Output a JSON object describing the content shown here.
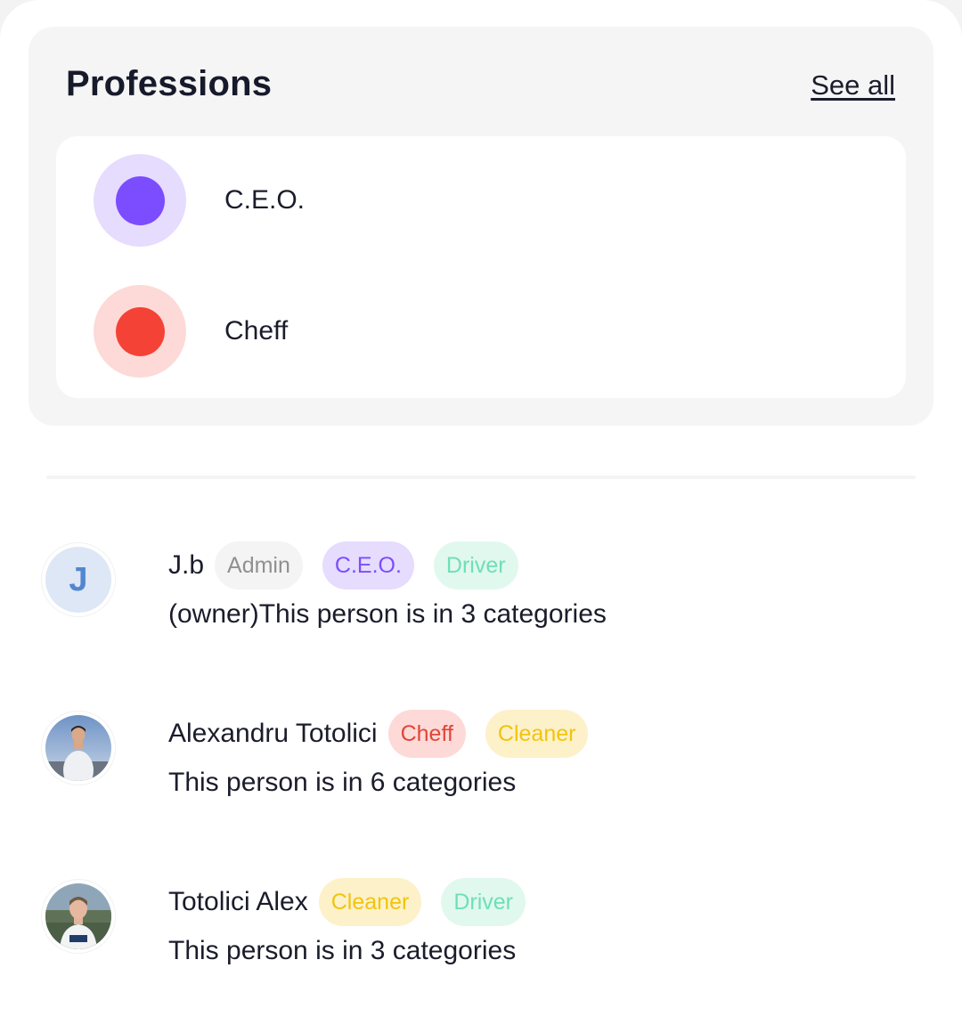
{
  "professions": {
    "title": "Professions",
    "see_all_label": "See all",
    "items": [
      {
        "label": "C.E.O.",
        "outer_color": "#e6dcfd",
        "inner_color": "#7b4dff"
      },
      {
        "label": "Cheff",
        "outer_color": "#fddad7",
        "inner_color": "#f44336"
      }
    ]
  },
  "members": [
    {
      "avatar_letter": "J",
      "name": "J.b",
      "tags": [
        {
          "label": "Admin",
          "bg": "#f4f4f4",
          "fg": "#909090"
        },
        {
          "label": "C.E.O.",
          "bg": "#e6dcfd",
          "fg": "#7b4dff"
        },
        {
          "label": "Driver",
          "bg": "#e1f8ef",
          "fg": "#6ee0b4"
        }
      ],
      "description": "(owner)This person is in 3 categories"
    },
    {
      "avatar_icon": "person-photo",
      "name": "Alexandru Totolici",
      "tags": [
        {
          "label": "Cheff",
          "bg": "#fddad7",
          "fg": "#e0463a"
        },
        {
          "label": "Cleaner",
          "bg": "#fdf1c9",
          "fg": "#f1c40f"
        }
      ],
      "description": "This person is in 6 categories"
    },
    {
      "avatar_icon": "person-photo",
      "name": "Totolici Alex",
      "tags": [
        {
          "label": "Cleaner",
          "bg": "#fdf1c9",
          "fg": "#f1c40f"
        },
        {
          "label": "Driver",
          "bg": "#e1f8ef",
          "fg": "#6ee0b4"
        }
      ],
      "description": "This person is in 3 categories"
    }
  ]
}
